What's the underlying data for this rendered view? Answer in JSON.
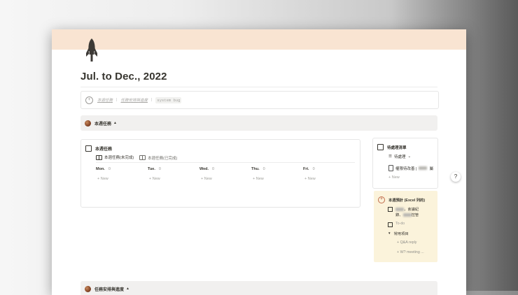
{
  "page": {
    "title": "Jul. to Dec., 2022"
  },
  "linkbar": {
    "link1": "本週任務",
    "sep1": "|",
    "link2": "任務安排與進度",
    "sep2": "|",
    "link3": "system bug"
  },
  "toggle1": {
    "label": "本週任務",
    "caret": "▲"
  },
  "tasks": {
    "header": "本週任務",
    "tabs": [
      {
        "label": "本週任務(未完成)"
      },
      {
        "label": "本週任務(已完成)"
      }
    ],
    "days": [
      {
        "name": "Mon.",
        "count": "0",
        "new": "+ New"
      },
      {
        "name": "Tue.",
        "count": "0",
        "new": "+ New"
      },
      {
        "name": "Wed.",
        "count": "0",
        "new": "+ New"
      },
      {
        "name": "Thu.",
        "count": "0",
        "new": "+ New"
      },
      {
        "name": "Fri.",
        "count": "0",
        "new": "+ New"
      }
    ]
  },
  "pending": {
    "header": "待處理清單",
    "filter": "待處理",
    "item": "權限待改善 |",
    "item_suffix": "屬",
    "new": "+ New"
  },
  "notes": {
    "header": "本週預計 (Excel 列的)",
    "item1_line1": "，會議紀",
    "item1_line2": "錄、",
    "item1_line2b": "控管",
    "item2": "To-do",
    "group": "常用項目",
    "sub1": "+ Q&A reply",
    "sub2": "+ W? meeting ..."
  },
  "toggle2": {
    "label": "任務安排與進度",
    "caret": "▲"
  },
  "help": {
    "label": "?"
  },
  "colors": {
    "cover": "#f9e4d2",
    "toggle_bg": "#f1f0ef",
    "note_bg": "#fbf3db"
  }
}
